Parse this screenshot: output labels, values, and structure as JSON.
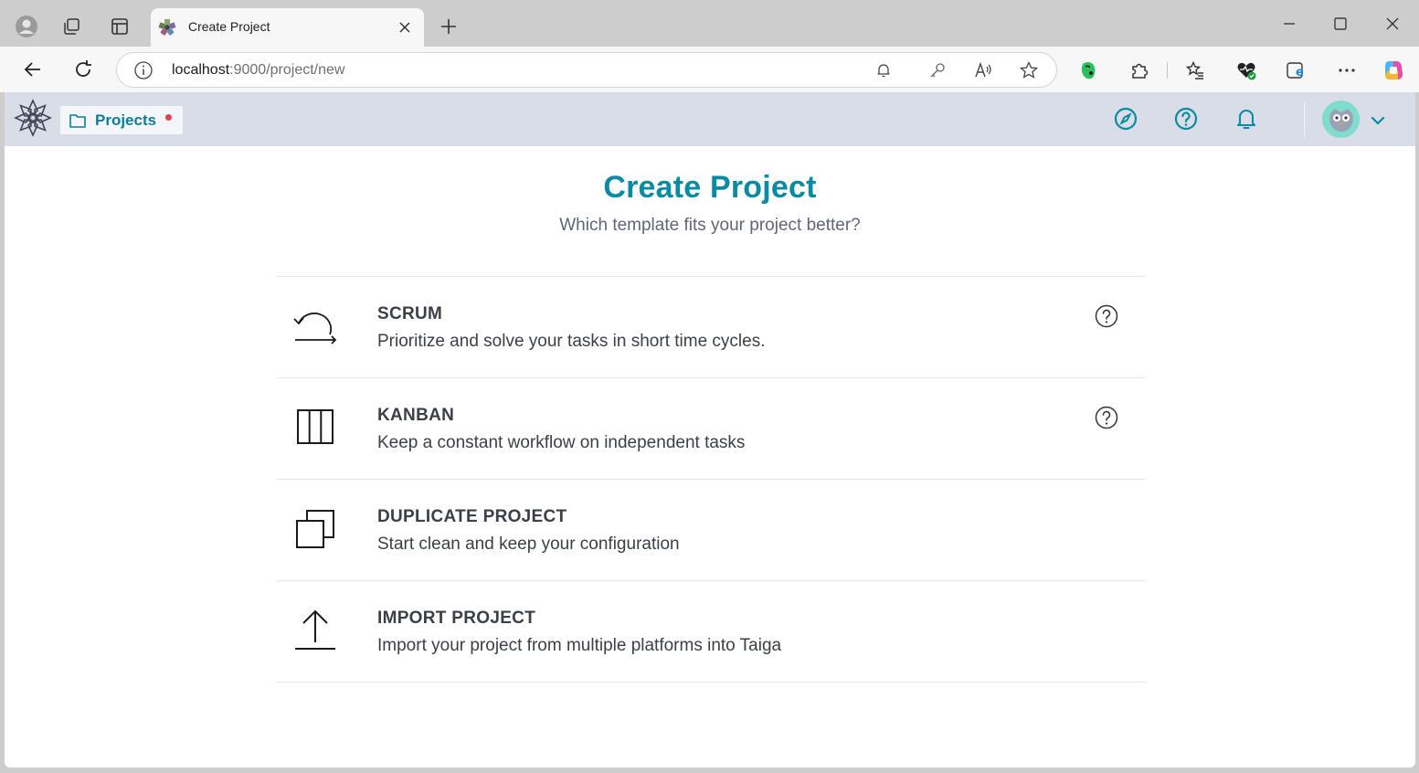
{
  "browser": {
    "tab_title": "Create Project",
    "url_host": "localhost",
    "url_rest": ":9000/project/new"
  },
  "app": {
    "projects_label": "Projects"
  },
  "page": {
    "title": "Create Project",
    "subtitle": "Which template fits your project better?"
  },
  "options": [
    {
      "name": "SCRUM",
      "description": "Prioritize and solve your tasks in short time cycles.",
      "icon": "scrum-cycle-icon",
      "help": true
    },
    {
      "name": "KANBAN",
      "description": "Keep a constant workflow on independent tasks",
      "icon": "kanban-columns-icon",
      "help": true
    },
    {
      "name": "DUPLICATE PROJECT",
      "description": "Start clean and keep your configuration",
      "icon": "duplicate-icon",
      "help": false
    },
    {
      "name": "IMPORT PROJECT",
      "description": "Import your project from multiple platforms into Taiga",
      "icon": "upload-icon",
      "help": false
    }
  ],
  "colors": {
    "accent": "#0a8aa3",
    "appbar": "#d8dde8",
    "notification_dot": "#e2414d",
    "avatar_bg": "#80dccc"
  }
}
